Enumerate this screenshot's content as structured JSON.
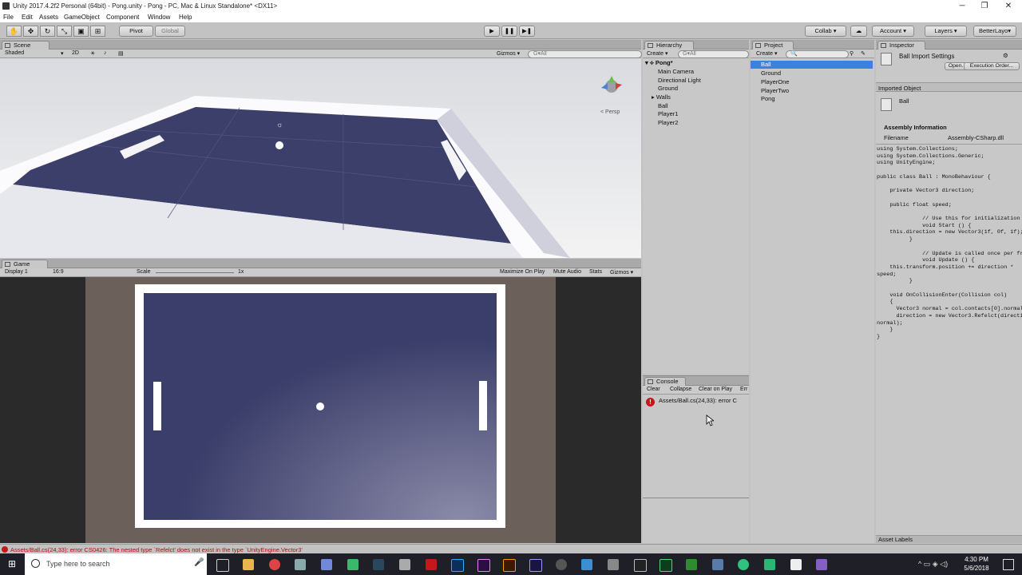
{
  "window": {
    "title": "Unity 2017.4.2f2 Personal (64bit) - Pong.unity - Pong - PC, Mac & Linux Standalone* <DX11>",
    "minimize": "─",
    "maximize": "❐",
    "close": "✕"
  },
  "menu": [
    "File",
    "Edit",
    "Assets",
    "GameObject",
    "Component",
    "Window",
    "Help"
  ],
  "toolbar": {
    "pivot": "Pivot",
    "global": "Global",
    "collab": "Collab ▾",
    "account": "Account ▾",
    "layers": "Layers ▾",
    "layout": "BetterLayo▾"
  },
  "scene": {
    "tab": "Scene",
    "shading": "Shaded",
    "mode2d": "2D",
    "gizmos": "Gizmos ▾",
    "search_placeholder": "G▾All",
    "persp": "< Persp"
  },
  "game": {
    "tab": "Game",
    "display": "Display 1",
    "aspect": "16:9",
    "scale_label": "Scale",
    "scale_value": "1x",
    "maximize": "Maximize On Play",
    "mute": "Mute Audio",
    "stats": "Stats",
    "gizmos": "Gizmos ▾"
  },
  "hierarchy": {
    "tab": "Hierarchy",
    "create": "Create ▾",
    "search_placeholder": "G▾All",
    "scene_name": "Pong*",
    "items": [
      "Main Camera",
      "Directional Light",
      "Ground",
      "Walls",
      "Ball",
      "Player1",
      "Player2"
    ]
  },
  "project": {
    "tab": "Project",
    "create": "Create ▾",
    "items": [
      "Ball",
      "Ground",
      "PlayerOne",
      "PlayerTwo",
      "Pong"
    ]
  },
  "inspector": {
    "tab": "Inspector",
    "header": "Ball Import Settings",
    "open": "Open...",
    "execution_order": "Execution Order...",
    "imported_object": "Imported Object",
    "object_name": "Ball",
    "assembly_info": "Assembly Information",
    "filename_label": "Filename",
    "filename_value": "Assembly-CSharp.dll",
    "code": "using System.Collections;\nusing System.Collections.Generic;\nusing UnityEngine;\n\npublic class Ball : MonoBehaviour {\n\n    private Vector3 direction;\n\n    public float speed;\n\n              // Use this for initialization\n              void Start () {\n    this.direction = new Vector3(1f, 0f, 1f);\n          }\n\n              // Update is called once per frame\n              void Update () {\n    this.transform.position += direction *\nspeed;\n          }\n\n    void OnCollisionEnter(Collision col)\n    {\n      Vector3 normal = col.contacts[0].normal;\n      direction = new Vector3.Refelct(direction,\nnormal);\n    }\n}",
    "asset_labels": "Asset Labels"
  },
  "console": {
    "tab": "Console",
    "clear": "Clear",
    "collapse": "Collapse",
    "clear_on_play": "Clear on Play",
    "error_pause": "Err",
    "entry": "Assets/Ball.cs(24,33): error C"
  },
  "status": {
    "message": "Assets/Ball.cs(24,33): error CS0426: The nested type `Refelct' does not exist in the type `UnityEngine.Vector3'"
  },
  "taskbar": {
    "search_placeholder": "Type here to search",
    "time": "4:30 PM",
    "date": "5/6/2018"
  },
  "colors": {
    "field": "#3b3e6a",
    "error": "#c4161c",
    "selection": "#3d80df"
  }
}
